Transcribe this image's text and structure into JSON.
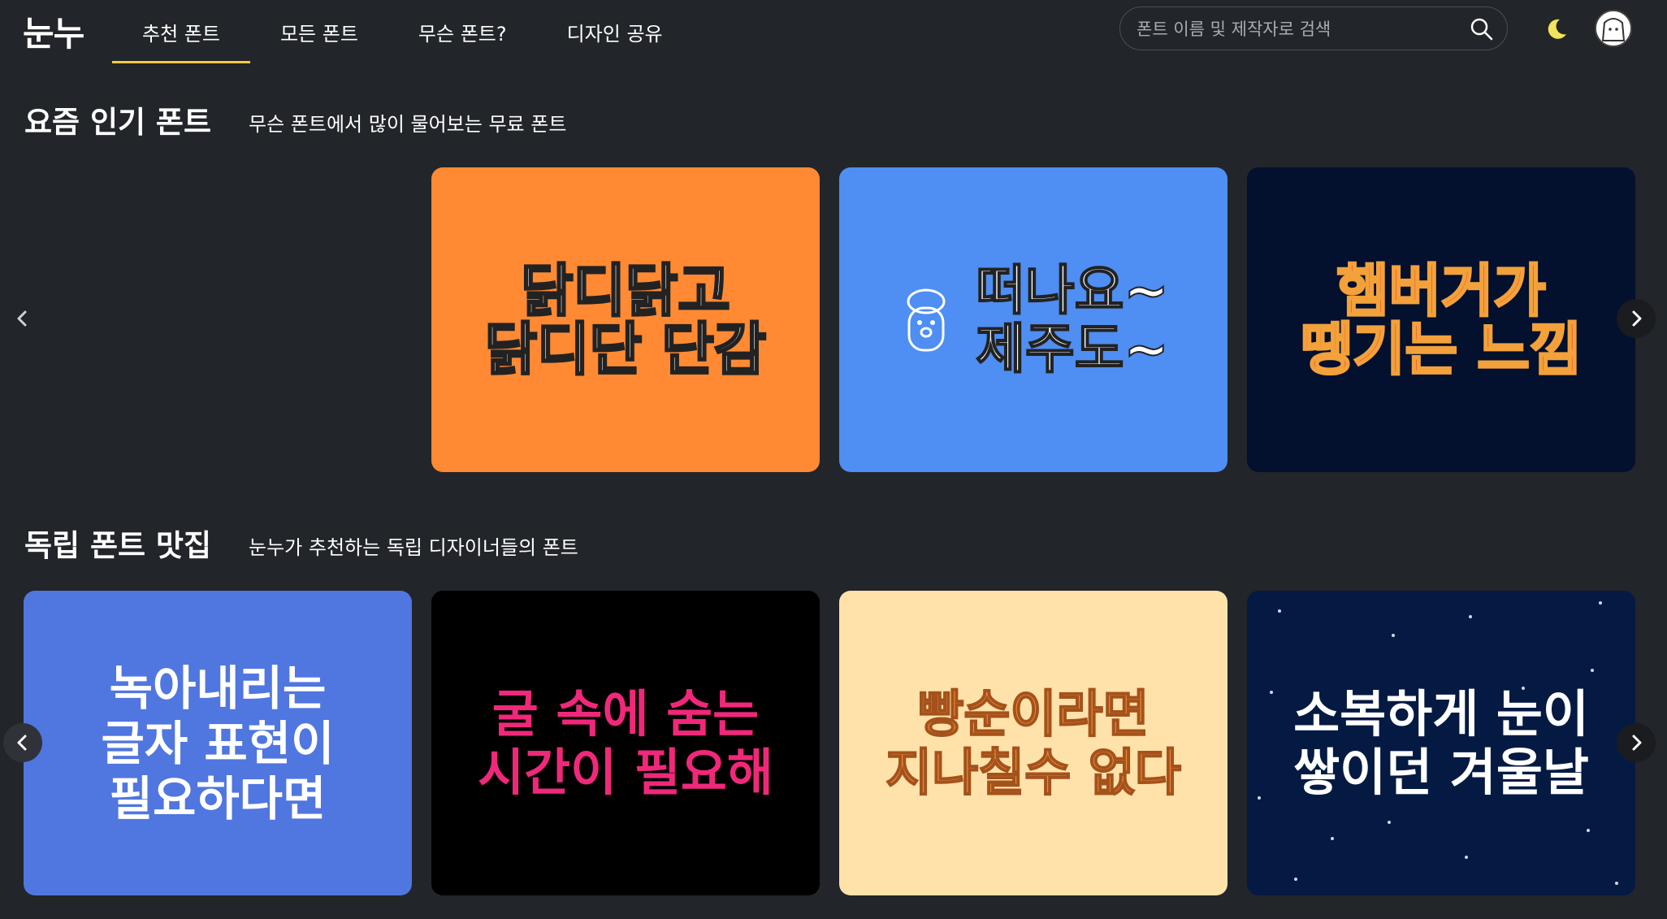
{
  "header": {
    "logo": "눈누",
    "nav": [
      "추천 폰트",
      "모든 폰트",
      "무슨 폰트?",
      "디자인 공유"
    ],
    "search_placeholder": "폰트 이름 및 제작자로 검색"
  },
  "popular": {
    "title": "요즘 인기 폰트",
    "subtitle": "무슨 폰트에서 많이 물어보는 무료 폰트",
    "cards": [
      {
        "text": "닭디닭고\n닭디단 단감",
        "bg": "#ff8a33",
        "color": "#ffffff"
      },
      {
        "text": "떠나요~\n제주도~",
        "bg": "#4f8ef2",
        "color": "#ffffff"
      },
      {
        "text": "햄버거가\n땡기는 느낌",
        "bg": "#03102e",
        "color": "#ef3b2d"
      }
    ]
  },
  "indie": {
    "title": "독립 폰트 맛집",
    "subtitle": "눈누가 추천하는 독립 디자이너들의 폰트",
    "cards": [
      {
        "text": "녹아내리는\n글자 표현이\n필요하다면",
        "bg": "#5076df",
        "color": "#ffffff"
      },
      {
        "text": "굴 속에 숨는\n시간이 필요해",
        "bg": "#000000",
        "color": "#f0287a"
      },
      {
        "text": "빵순이라면\n지나칠수 없다",
        "bg": "#ffe2aa",
        "color": "#f08a35"
      },
      {
        "text": "소복하게 눈이\n쌓이던 겨울날",
        "bg": "#051a42",
        "color": "#ffffff"
      }
    ]
  },
  "colors": {
    "accent": "#f2c94c",
    "background": "#222529"
  },
  "icons": [
    "search-icon",
    "moon-icon",
    "chevron-left-icon",
    "chevron-right-icon",
    "dolharubang-icon"
  ]
}
